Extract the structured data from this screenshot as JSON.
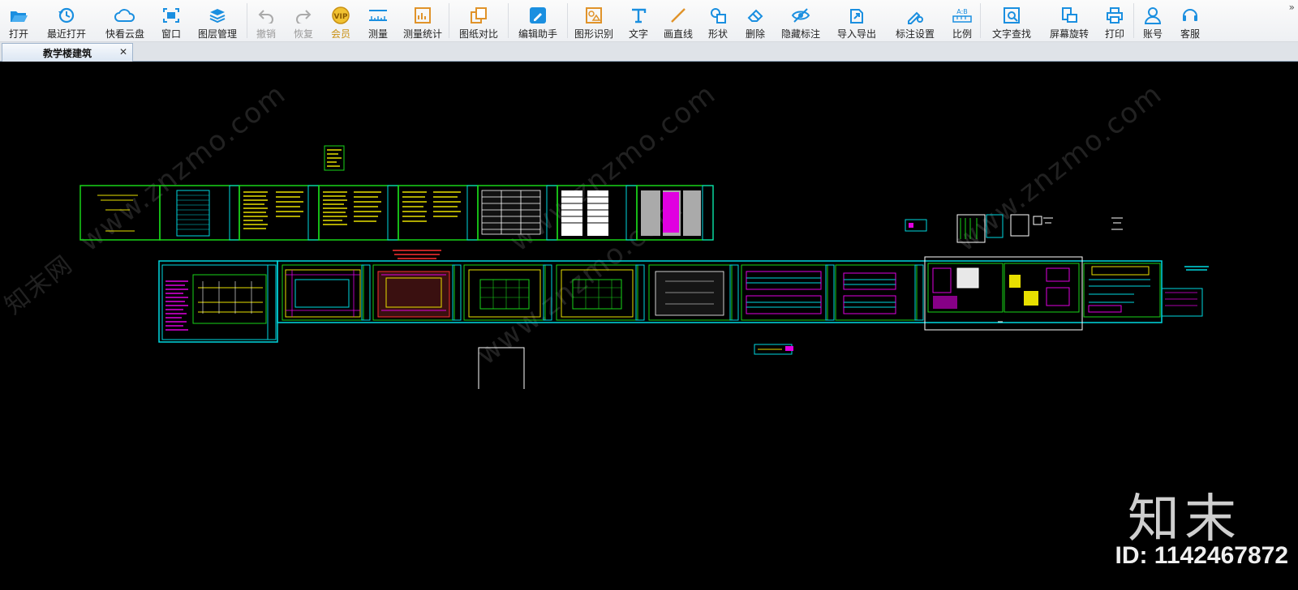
{
  "toolbar": {
    "items": [
      {
        "label": "打开",
        "icon": "folder-open-icon"
      },
      {
        "label": "最近打开",
        "icon": "recent-icon"
      },
      {
        "label": "快看云盘",
        "icon": "cloud-icon"
      },
      {
        "label": "窗口",
        "icon": "window-icon"
      },
      {
        "label": "图层管理",
        "icon": "layers-icon"
      },
      {
        "label": "撤销",
        "icon": "undo-icon"
      },
      {
        "label": "恢复",
        "icon": "redo-icon"
      },
      {
        "label": "会员",
        "icon": "vip-icon"
      },
      {
        "label": "测量",
        "icon": "measure-icon"
      },
      {
        "label": "测量统计",
        "icon": "measure-stats-icon"
      },
      {
        "label": "图纸对比",
        "icon": "compare-icon"
      },
      {
        "label": "编辑助手",
        "icon": "edit-assistant-icon"
      },
      {
        "label": "图形识别",
        "icon": "shape-recognize-icon"
      },
      {
        "label": "文字",
        "icon": "text-icon"
      },
      {
        "label": "画直线",
        "icon": "line-icon"
      },
      {
        "label": "形状",
        "icon": "shapes-icon"
      },
      {
        "label": "删除",
        "icon": "eraser-icon"
      },
      {
        "label": "隐藏标注",
        "icon": "hide-annotation-icon"
      },
      {
        "label": "导入导出",
        "icon": "import-export-icon"
      },
      {
        "label": "标注设置",
        "icon": "annotation-settings-icon"
      },
      {
        "label": "比例",
        "icon": "scale-icon"
      },
      {
        "label": "文字查找",
        "icon": "text-search-icon"
      },
      {
        "label": "屏幕旋转",
        "icon": "rotate-screen-icon"
      },
      {
        "label": "打印",
        "icon": "print-icon"
      },
      {
        "label": "账号",
        "icon": "account-icon"
      },
      {
        "label": "客服",
        "icon": "support-icon"
      }
    ],
    "more": "»"
  },
  "tab": {
    "title": "教学楼建筑",
    "close": "✕"
  },
  "watermarks": [
    "www.znzmo.com",
    "www.znzmo.com",
    "www.znzmo.com",
    "www.znzmo.com",
    "知末网"
  ],
  "brand": {
    "name": "知末",
    "id": "ID: 1142467872"
  },
  "colors": {
    "accent": "#1a8fe0",
    "vip": "#d4a017",
    "cad_green": "#19d419",
    "cad_yellow": "#e8e000",
    "cad_magenta": "#e000e0",
    "cad_cyan": "#00d8e0"
  }
}
